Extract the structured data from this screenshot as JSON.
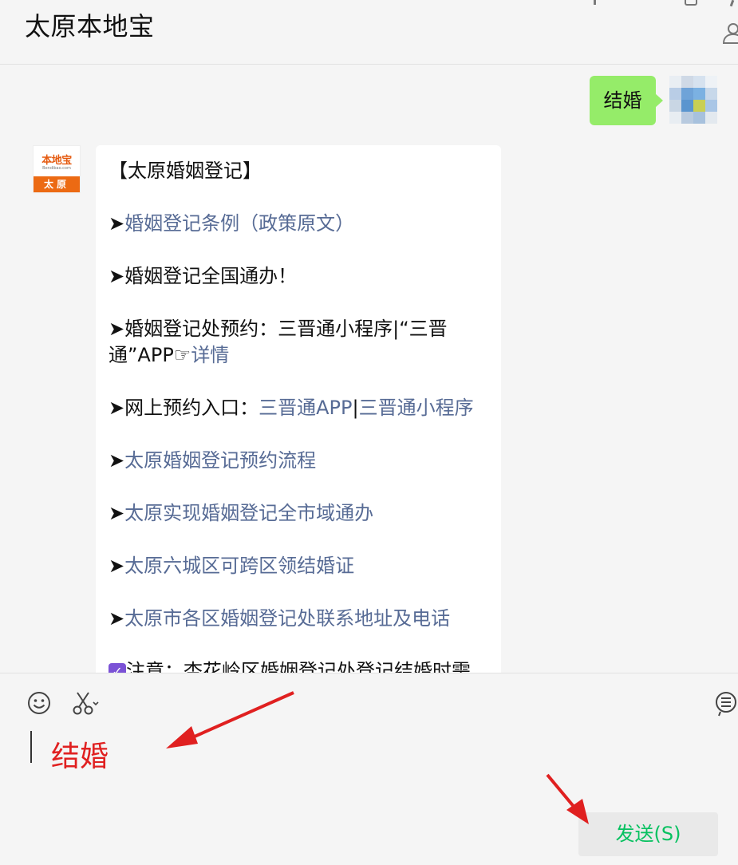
{
  "header": {
    "title": "太原本地宝"
  },
  "chat": {
    "sent_message": "结婚",
    "bot_avatar": {
      "logo_text": "本地宝",
      "logo_url": "Bendibao.com",
      "city": "太原"
    },
    "bot_reply": {
      "heading": "【太原婚姻登记】",
      "bullet": "➤",
      "items": [
        {
          "text": "婚姻登记条例（政策原文）",
          "link": true
        },
        {
          "text": "婚姻登记全国通办！",
          "link": false
        },
        {
          "prefix": "婚姻登记处预约：三晋通小程序|“三晋通”APP☞",
          "link_text": "详情"
        },
        {
          "prefix": "网上预约入口：",
          "link_a": "三晋通APP",
          "sep": "|",
          "link_b": "三晋通小程序"
        },
        {
          "text": "太原婚姻登记预约流程",
          "link": true
        },
        {
          "text": "太原实现婚姻登记全市域通办",
          "link": true
        },
        {
          "text": "太原六城区可跨区领结婚证",
          "link": true
        },
        {
          "text": "太原市各区婚姻登记处联系地址及电话",
          "link": true
        }
      ],
      "note_partial": "注意：杏花岭区婚姻登记处登记结婚时需"
    }
  },
  "input": {
    "text": "结婚",
    "send_label": "发送(S)"
  },
  "icons": {
    "emoji": "emoji-icon",
    "scissors": "scissors-icon",
    "history": "chat-history-icon",
    "person": "person-icon"
  },
  "colors": {
    "sent_bubble": "#95ec69",
    "link": "#576b95",
    "send_text": "#07c160",
    "annotation": "#e02020"
  }
}
